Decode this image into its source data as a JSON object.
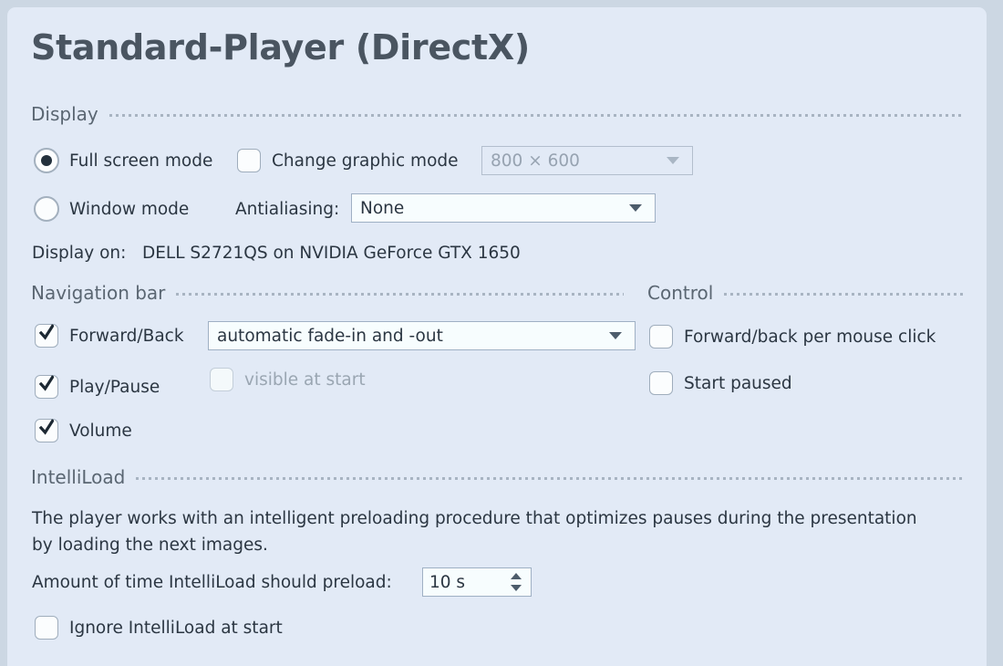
{
  "page": {
    "title": "Standard-Player (DirectX)",
    "background_color": "#ccd7e3",
    "panel_color": "#e2eaf6"
  },
  "display_group": {
    "header": "Display",
    "full_screen": {
      "label": "Full screen mode",
      "selected": true
    },
    "window_mode": {
      "label": "Window mode",
      "selected": false
    },
    "change_graphic_mode": {
      "label": "Change graphic mode",
      "checked": false
    },
    "resolution": {
      "value": "800 × 600",
      "enabled": false
    },
    "antialiasing": {
      "label": "Antialiasing:",
      "value": "None",
      "enabled": true
    },
    "display_on": {
      "label": "Display on:",
      "value": "DELL S2721QS on NVIDIA GeForce GTX 1650"
    }
  },
  "navigation_group": {
    "header": "Navigation bar",
    "forward_back": {
      "label": "Forward/Back",
      "checked": true
    },
    "fade_mode": {
      "value": "automatic fade-in and -out",
      "enabled": true
    },
    "play_pause": {
      "label": "Play/Pause",
      "checked": true
    },
    "visible_at_start": {
      "label": "visible at start",
      "checked": false,
      "enabled": false
    },
    "volume": {
      "label": "Volume",
      "checked": true
    }
  },
  "control_group": {
    "header": "Control",
    "forward_back_mouse": {
      "label": "Forward/back per mouse click",
      "checked": false
    },
    "start_paused": {
      "label": "Start paused",
      "checked": false
    }
  },
  "intelliload_group": {
    "header": "IntelliLoad",
    "description_line1": "The player works with an intelligent preloading procedure that optimizes pauses during the presentation",
    "description_line2": "by loading the next images.",
    "preload_label": "Amount of time IntelliLoad should preload:",
    "preload_value": "10 s",
    "ignore_at_start": {
      "label": "Ignore IntelliLoad at start",
      "checked": false
    }
  }
}
